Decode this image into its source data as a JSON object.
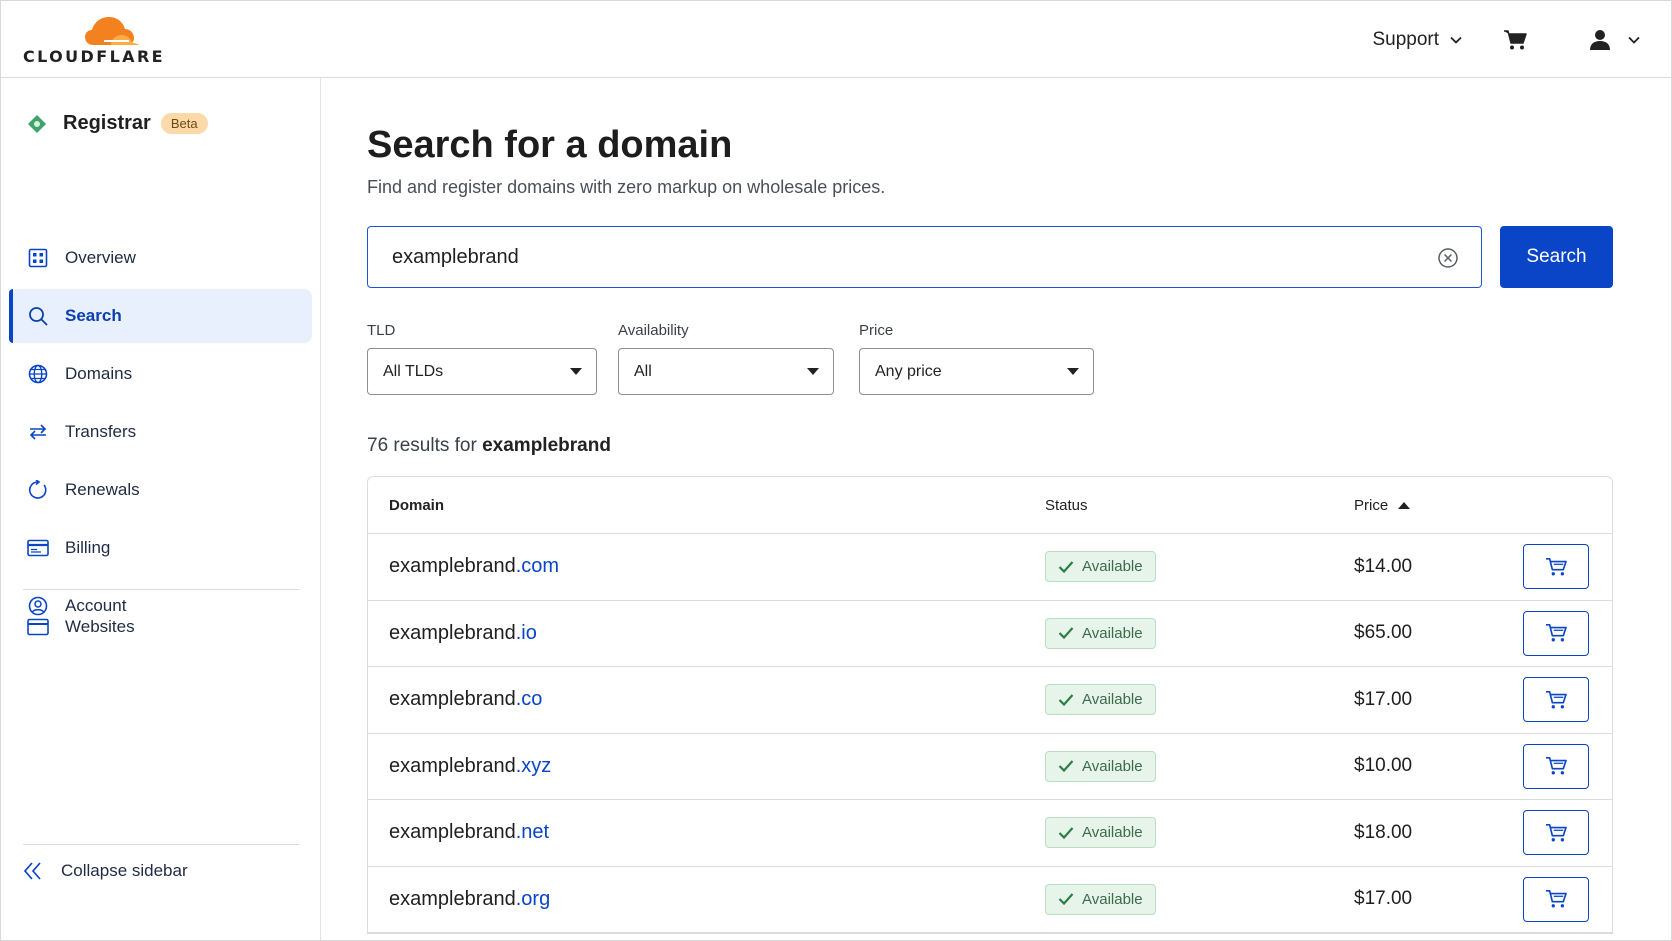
{
  "brand": {
    "name": "CLOUDFLARE"
  },
  "header": {
    "support_label": "Support"
  },
  "sidebar": {
    "section_title": "Registrar",
    "badge": "Beta",
    "items": [
      {
        "label": "Overview",
        "icon": "overview-icon"
      },
      {
        "label": "Search",
        "icon": "search-icon",
        "active": true
      },
      {
        "label": "Domains",
        "icon": "globe-icon"
      },
      {
        "label": "Transfers",
        "icon": "transfer-arrows-icon"
      },
      {
        "label": "Renewals",
        "icon": "refresh-icon"
      },
      {
        "label": "Billing",
        "icon": "billing-icon"
      },
      {
        "label": "Account",
        "icon": "account-icon"
      }
    ],
    "websites_label": "Websites",
    "collapse_label": "Collapse sidebar"
  },
  "main": {
    "title": "Search for a domain",
    "subtitle": "Find and register domains with zero markup on wholesale prices.",
    "search": {
      "value": "examplebrand",
      "button_label": "Search"
    },
    "filters": {
      "tld": {
        "label": "TLD",
        "value": "All TLDs"
      },
      "availability": {
        "label": "Availability",
        "value": "All"
      },
      "price": {
        "label": "Price",
        "value": "Any price"
      }
    },
    "results": {
      "prefix": "76 results for",
      "query": "examplebrand"
    },
    "table": {
      "columns": {
        "domain": "Domain",
        "status": "Status",
        "price": "Price"
      },
      "rows": [
        {
          "name": "examplebrand",
          "tld": ".com",
          "status": "Available",
          "price": "$14.00"
        },
        {
          "name": "examplebrand",
          "tld": ".io",
          "status": "Available",
          "price": "$65.00"
        },
        {
          "name": "examplebrand",
          "tld": ".co",
          "status": "Available",
          "price": "$17.00"
        },
        {
          "name": "examplebrand",
          "tld": ".xyz",
          "status": "Available",
          "price": "$10.00"
        },
        {
          "name": "examplebrand",
          "tld": ".net",
          "status": "Available",
          "price": "$18.00"
        },
        {
          "name": "examplebrand",
          "tld": ".org",
          "status": "Available",
          "price": "$17.00"
        }
      ]
    }
  },
  "colors": {
    "accent": "#0a45c7",
    "brand_orange": "#f48120",
    "available_bg": "#e6f4ea",
    "beta_bg": "#fbd9a8"
  }
}
